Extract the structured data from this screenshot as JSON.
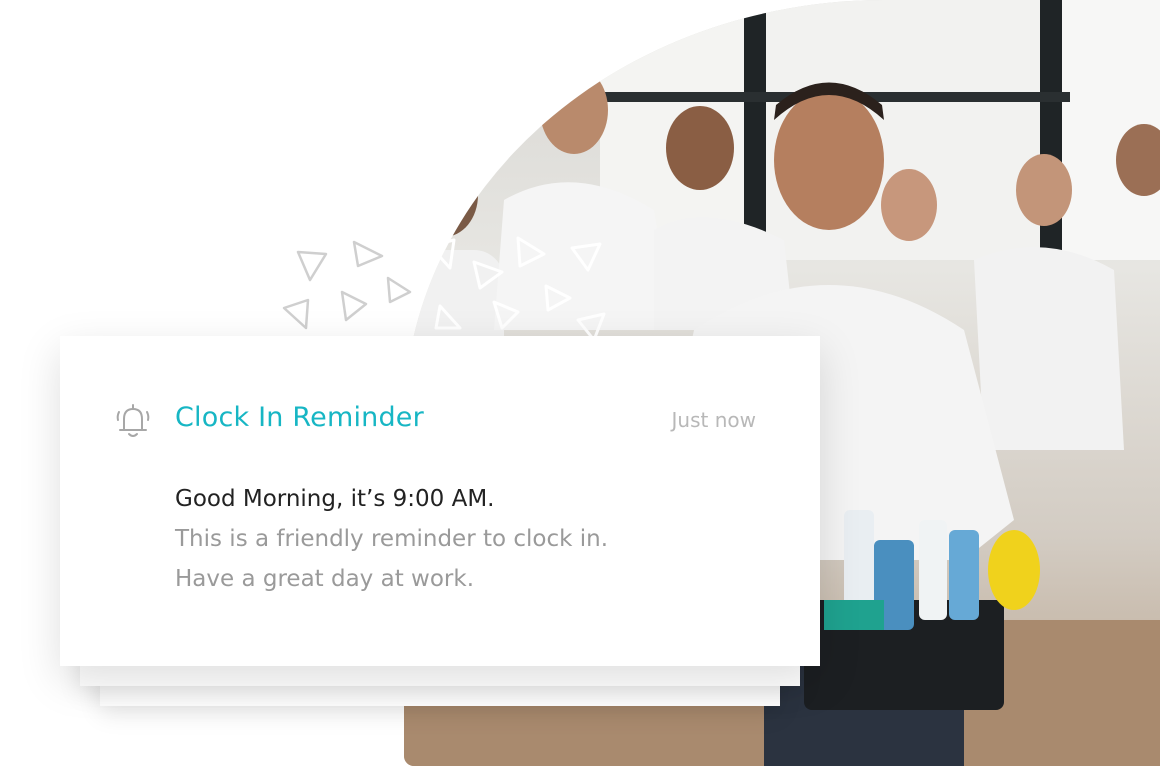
{
  "photo": {
    "description_icon": "team-photo"
  },
  "notification": {
    "icon": "bell-icon",
    "title": "Clock In Reminder",
    "timestamp": "Just now",
    "greeting": "Good Morning, it’s 9:00 AM.",
    "lines": [
      "This is a friendly reminder to clock in.",
      "Have a great day at work."
    ]
  },
  "colors": {
    "accent": "#17b6c4",
    "title_text": "#222222",
    "muted_text": "#9a9a9a",
    "timestamp_text": "#b8b8b8"
  }
}
